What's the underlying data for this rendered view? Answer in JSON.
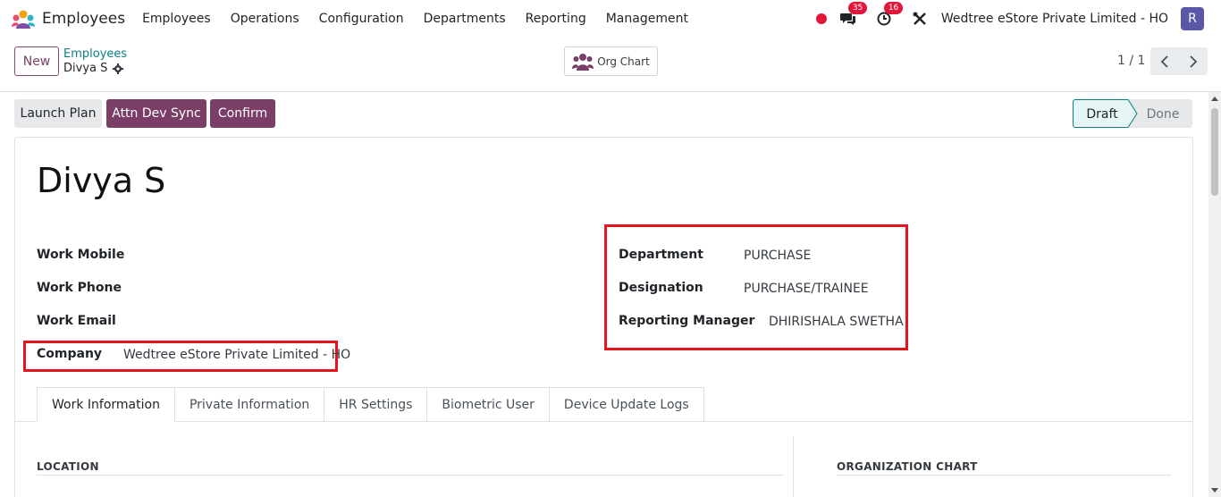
{
  "navbar": {
    "app_title": "Employees",
    "menu": [
      "Employees",
      "Operations",
      "Configuration",
      "Departments",
      "Reporting",
      "Management"
    ],
    "messages_count": "35",
    "activities_count": "16",
    "company": "Wedtree eStore Private Limited - HO",
    "user_initial": "R"
  },
  "control": {
    "new_label": "New",
    "breadcrumb_parent": "Employees",
    "breadcrumb_current": "Divya S",
    "org_chart_label": "Org Chart",
    "pager": "1 / 1"
  },
  "statusbar": {
    "buttons": [
      "Launch Plan",
      "Attn Dev Sync",
      "Confirm"
    ],
    "stages": [
      "Draft",
      "Done"
    ],
    "active_stage": "Draft"
  },
  "employee": {
    "name": "Divya S",
    "fields_left": [
      {
        "label": "Work Mobile",
        "value": ""
      },
      {
        "label": "Work Phone",
        "value": ""
      },
      {
        "label": "Work Email",
        "value": ""
      }
    ],
    "company_label": "Company",
    "company_value": "Wedtree eStore Private Limited - HO",
    "fields_right": [
      {
        "label": "Department",
        "value": "PURCHASE"
      },
      {
        "label": "Designation",
        "value": "PURCHASE/TRAINEE"
      },
      {
        "label": "Reporting Manager",
        "value": "DHIRISHALA SWETHA"
      }
    ]
  },
  "tabs": [
    "Work Information",
    "Private Information",
    "HR Settings",
    "Biometric User",
    "Device Update Logs"
  ],
  "sections": {
    "location": "LOCATION",
    "org_chart": "ORGANIZATION CHART"
  },
  "colors": {
    "primary": "#7b3e67",
    "link": "#0e7e82",
    "highlight": "#e5151e",
    "badge": "#e0163a"
  }
}
